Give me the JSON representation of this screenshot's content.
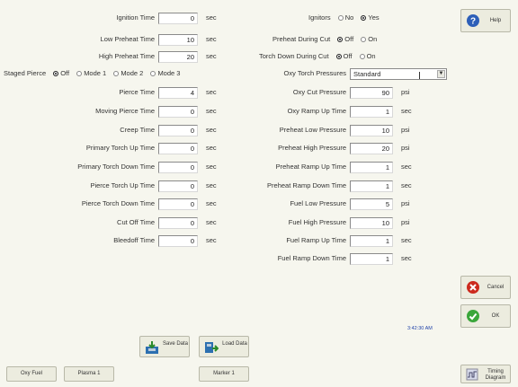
{
  "left_rows": [
    {
      "label": "Ignition Time",
      "value": "0",
      "unit": "sec"
    },
    {
      "label": "Low Preheat Time",
      "value": "10",
      "unit": "sec"
    },
    {
      "label": "High Preheat Time",
      "value": "20",
      "unit": "sec"
    },
    {
      "label": "Pierce Time",
      "value": "4",
      "unit": "sec"
    },
    {
      "label": "Moving Pierce Time",
      "value": "0",
      "unit": "sec"
    },
    {
      "label": "Creep Time",
      "value": "0",
      "unit": "sec"
    },
    {
      "label": "Primary Torch Up Time",
      "value": "0",
      "unit": "sec"
    },
    {
      "label": "Primary Torch Down Time",
      "value": "0",
      "unit": "sec"
    },
    {
      "label": "Pierce Torch Up Time",
      "value": "0",
      "unit": "sec"
    },
    {
      "label": "Pierce Torch Down Time",
      "value": "0",
      "unit": "sec"
    },
    {
      "label": "Cut Off Time",
      "value": "0",
      "unit": "sec"
    },
    {
      "label": "Bleedoff Time",
      "value": "0",
      "unit": "sec"
    }
  ],
  "staged_pierce": {
    "label": "Staged Pierce",
    "options": [
      "Off",
      "Mode 1",
      "Mode 2",
      "Mode 3"
    ],
    "selected": "Off"
  },
  "ignitors": {
    "label": "Ignitors",
    "options": [
      "No",
      "Yes"
    ],
    "selected": "Yes"
  },
  "preheat_during_cut": {
    "label": "Preheat During Cut",
    "options": [
      "Off",
      "On"
    ],
    "selected": "Off"
  },
  "torch_down_during_cut": {
    "label": "Torch Down During Cut",
    "options": [
      "Off",
      "On"
    ],
    "selected": "Off"
  },
  "oxy_torch_pressures": {
    "label": "Oxy Torch Pressures",
    "value": "Standard"
  },
  "right_rows": [
    {
      "label": "Oxy Cut Pressure",
      "value": "90",
      "unit": "psi"
    },
    {
      "label": "Oxy Ramp Up Time",
      "value": "1",
      "unit": "sec"
    },
    {
      "label": "Preheat Low Pressure",
      "value": "10",
      "unit": "psi"
    },
    {
      "label": "Preheat High Pressure",
      "value": "20",
      "unit": "psi"
    },
    {
      "label": "Preheat Ramp Up Time",
      "value": "1",
      "unit": "sec"
    },
    {
      "label": "Preheat Ramp Down Time",
      "value": "1",
      "unit": "sec"
    },
    {
      "label": "Fuel Low Pressure",
      "value": "5",
      "unit": "psi"
    },
    {
      "label": "Fuel High Pressure",
      "value": "10",
      "unit": "psi"
    },
    {
      "label": "Fuel Ramp Up Time",
      "value": "1",
      "unit": "sec"
    },
    {
      "label": "Fuel Ramp Down Time",
      "value": "1",
      "unit": "sec"
    }
  ],
  "buttons": {
    "help": "Help",
    "cancel": "Cancel",
    "ok": "OK",
    "save_data": "Save Data",
    "load_data": "Load Data",
    "oxy_fuel": "Oxy Fuel",
    "plasma1": "Plasma 1",
    "marker1": "Marker 1",
    "timing_diagram": "Timing Diagram"
  },
  "clock": "3:42:30 AM",
  "colors": {
    "help": "#2d5fb8",
    "cancel": "#cc2a1e",
    "ok": "#3aa63a"
  }
}
